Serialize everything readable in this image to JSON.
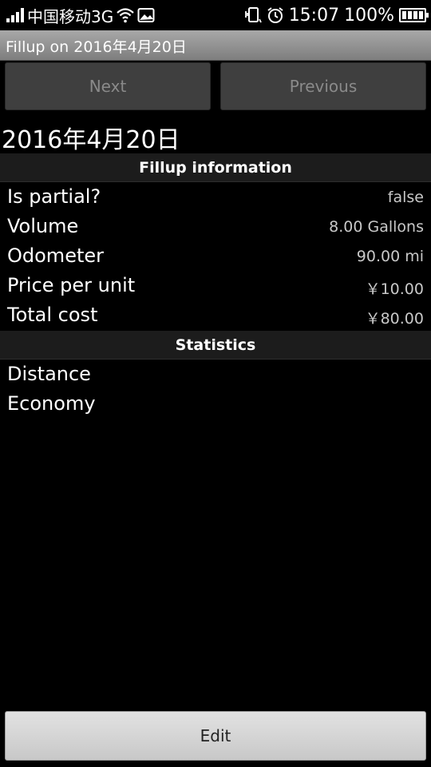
{
  "status_bar": {
    "carrier": "中国移动3G",
    "time": "15:07",
    "battery_percent": "100%",
    "icons": [
      "signal-icon",
      "wifi-icon",
      "image-icon",
      "vibrate-icon",
      "alarm-icon",
      "battery-icon"
    ]
  },
  "title_bar": {
    "title": "Fillup on 2016年4月20日"
  },
  "nav": {
    "next_label": "Next",
    "previous_label": "Previous"
  },
  "date_heading": "2016年4月20日",
  "fillup_section": {
    "header": "Fillup information",
    "rows": [
      {
        "label": "Is partial?",
        "value": "false"
      },
      {
        "label": "Volume",
        "value": "8.00 Gallons"
      },
      {
        "label": "Odometer",
        "value": "90.00 mi"
      },
      {
        "label": "Price per unit",
        "value": "￥10.00"
      },
      {
        "label": "Total cost",
        "value": "￥80.00"
      }
    ]
  },
  "statistics_section": {
    "header": "Statistics",
    "rows": [
      {
        "label": "Distance",
        "value": ""
      },
      {
        "label": "Economy",
        "value": ""
      }
    ]
  },
  "edit_label": "Edit"
}
